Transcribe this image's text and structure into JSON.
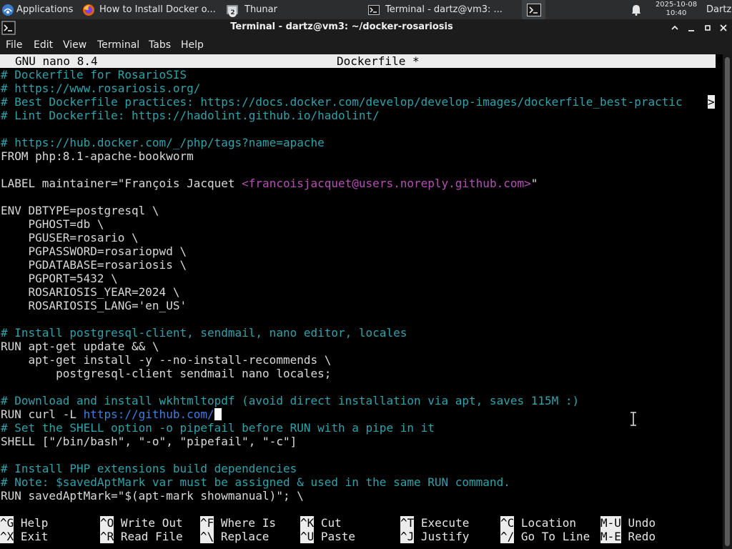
{
  "panel": {
    "applications_label": "Applications",
    "tasks": [
      {
        "label": "How to Install Docker o...",
        "icon": "firefox-icon",
        "active": false
      },
      {
        "label": "Thunar",
        "icon": "file-manager-icon",
        "badge": "2",
        "active": false
      },
      {
        "label": "Terminal - dartz@vm3: ...",
        "icon": "terminal-icon",
        "active": false
      },
      {
        "label": "",
        "icon": "terminal-icon",
        "active": true
      }
    ],
    "clock_date": "2025-10-08",
    "clock_time": "10:40",
    "user": "Dartz"
  },
  "window": {
    "title": "Terminal - dartz@vm3: ~/docker-rosariosis"
  },
  "menubar": [
    "File",
    "Edit",
    "View",
    "Terminal",
    "Tabs",
    "Help"
  ],
  "nano": {
    "version": "GNU nano 8.4",
    "filename": "Dockerfile *",
    "truncation_marker": ">",
    "lines": [
      [
        {
          "t": "# Dockerfile for RosarioSIS",
          "c": "cm"
        }
      ],
      [
        {
          "t": "# https://www.rosariosis.org/",
          "c": "cm"
        }
      ],
      [
        {
          "t": "# Best Dockerfile practices: https://docs.docker.com/develop/develop-images/dockerfile_best-practic",
          "c": "cm"
        }
      ],
      [
        {
          "t": "# Lint Dockerfile: https://hadolint.github.io/hadolint/",
          "c": "cm"
        }
      ],
      [],
      [
        {
          "t": "# https://hub.docker.com/_/php/tags?name=apache",
          "c": "cm"
        }
      ],
      [
        {
          "t": "FROM php:8.1-apache-bookworm",
          "c": ""
        }
      ],
      [],
      [
        {
          "t": "LABEL maintainer=\"François Jacquet ",
          "c": ""
        },
        {
          "t": "<francoisjacquet@users.noreply.github.com>",
          "c": "str"
        },
        {
          "t": "\"",
          "c": ""
        }
      ],
      [],
      [
        {
          "t": "ENV DBTYPE=postgresql \\",
          "c": ""
        }
      ],
      [
        {
          "t": "    PGHOST=db \\",
          "c": ""
        }
      ],
      [
        {
          "t": "    PGUSER=rosario \\",
          "c": ""
        }
      ],
      [
        {
          "t": "    PGPASSWORD=rosariopwd \\",
          "c": ""
        }
      ],
      [
        {
          "t": "    PGDATABASE=rosariosis \\",
          "c": ""
        }
      ],
      [
        {
          "t": "    PGPORT=5432 \\",
          "c": ""
        }
      ],
      [
        {
          "t": "    ROSARIOSIS_YEAR=2024 \\",
          "c": ""
        }
      ],
      [
        {
          "t": "    ROSARIOSIS_LANG='en_US'",
          "c": ""
        }
      ],
      [],
      [
        {
          "t": "# Install postgresql-client, sendmail, nano editor, locales",
          "c": "cm"
        }
      ],
      [
        {
          "t": "RUN apt-get update && \\",
          "c": ""
        }
      ],
      [
        {
          "t": "    apt-get install -y --no-install-recommends \\",
          "c": ""
        }
      ],
      [
        {
          "t": "        postgresql-client sendmail nano locales;",
          "c": ""
        }
      ],
      [],
      [
        {
          "t": "# Download and install wkhtmltopdf (avoid direct installation via apt, saves 115M :)",
          "c": "cm"
        }
      ],
      [
        {
          "t": "RUN curl -L ",
          "c": ""
        },
        {
          "t": "https://github.com/",
          "c": "url"
        },
        {
          "t": "",
          "c": "cursor"
        }
      ],
      [
        {
          "t": "# Set the SHELL option -o pipefail before RUN with a pipe in it",
          "c": "cm"
        }
      ],
      [
        {
          "t": "SHELL [\"/bin/bash\", \"-o\", \"pipefail\", \"-c\"]",
          "c": ""
        }
      ],
      [],
      [
        {
          "t": "# Install PHP extensions build dependencies",
          "c": "cm"
        }
      ],
      [
        {
          "t": "# Note: $savedAptMark var must be assigned & used in the same RUN command.",
          "c": "cm"
        }
      ],
      [
        {
          "t": "RUN savedAptMark=\"$(apt-mark showmanual)\"; \\",
          "c": ""
        }
      ]
    ],
    "shortcuts": [
      [
        {
          "key": "^G",
          "label": "Help"
        },
        {
          "key": "^O",
          "label": "Write Out"
        },
        {
          "key": "^F",
          "label": "Where Is"
        },
        {
          "key": "^K",
          "label": "Cut"
        },
        {
          "key": "^T",
          "label": "Execute"
        },
        {
          "key": "^C",
          "label": "Location"
        },
        {
          "key": "M-U",
          "label": "Undo"
        }
      ],
      [
        {
          "key": "^X",
          "label": "Exit"
        },
        {
          "key": "^R",
          "label": "Read File"
        },
        {
          "key": "^\\",
          "label": "Replace"
        },
        {
          "key": "^U",
          "label": "Paste"
        },
        {
          "key": "^J",
          "label": "Justify"
        },
        {
          "key": "^/",
          "label": "Go To Line"
        },
        {
          "key": "M-E",
          "label": "Redo"
        }
      ]
    ]
  },
  "colors": {
    "comment": "#2fa2ab",
    "string": "#b54fb4",
    "url": "#3d7ee0",
    "text": "#d9d9d9",
    "nano_bar_bg": "#ececec",
    "background": "#000000"
  }
}
